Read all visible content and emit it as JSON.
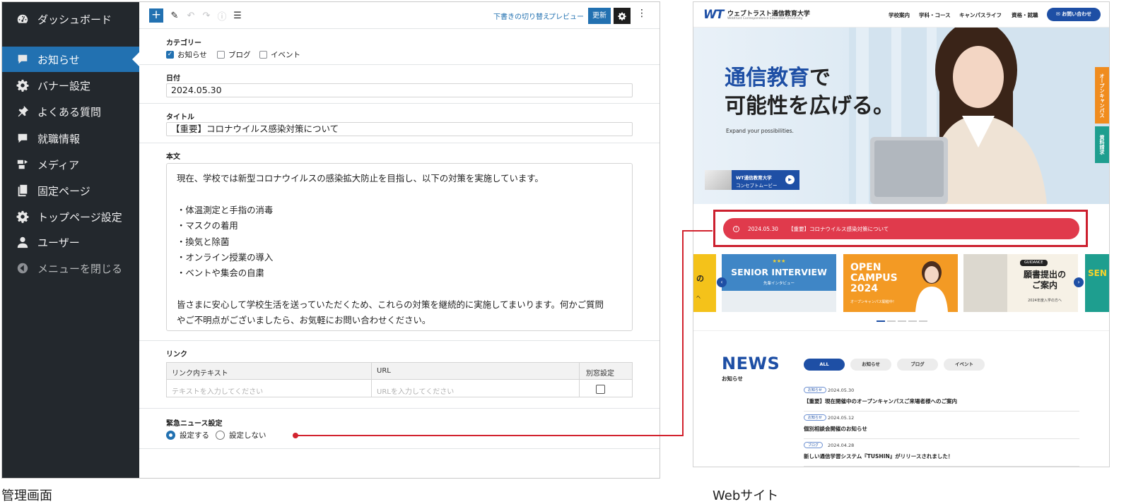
{
  "admin": {
    "sidebar": {
      "items": [
        {
          "label": "ダッシュボード",
          "icon": "dashboard-icon"
        },
        {
          "label": "お知らせ",
          "icon": "comment-icon",
          "active": true
        },
        {
          "label": "バナー設定",
          "icon": "gear-icon"
        },
        {
          "label": "よくある質問",
          "icon": "pin-icon"
        },
        {
          "label": "就職情報",
          "icon": "comment-icon"
        },
        {
          "label": "メディア",
          "icon": "media-icon"
        },
        {
          "label": "固定ページ",
          "icon": "pages-icon"
        },
        {
          "label": "トップページ設定",
          "icon": "gear-icon"
        },
        {
          "label": "ユーザー",
          "icon": "user-icon"
        },
        {
          "label": "メニューを閉じる",
          "icon": "collapse-icon"
        }
      ]
    },
    "toolbar": {
      "add": "+",
      "draft_switch": "下書きの切り替え",
      "preview": "プレビュー",
      "update": "更新"
    },
    "category": {
      "label": "カテゴリー",
      "options": [
        {
          "label": "お知らせ",
          "checked": true
        },
        {
          "label": "ブログ",
          "checked": false
        },
        {
          "label": "イベント",
          "checked": false
        }
      ]
    },
    "date": {
      "label": "日付",
      "value": "2024.05.30"
    },
    "title": {
      "label": "タイトル",
      "value": "【重要】コロナウイルス感染対策について"
    },
    "body": {
      "label": "本文",
      "lines": [
        "現在、学校では新型コロナウイルスの感染拡大防止を目指し、以下の対策を実施しています。",
        "・体温測定と手指の消毒",
        "・マスクの着用",
        "・換気と除菌",
        "・オンライン授業の導入",
        "・ベントや集会の自粛",
        "皆さまに安心して学校生活を送っていただくため、これらの対策を継続的に実施してまいります。何かご質問",
        "やご不明点がございましたら、お気軽にお問い合わせください。"
      ]
    },
    "link": {
      "label": "リンク",
      "columns": [
        "リンク内テキスト",
        "URL",
        "別窓設定"
      ],
      "placeholders": [
        "テキストを入力してください",
        "URLを入力してください"
      ]
    },
    "emergency": {
      "label": "緊急ニュース設定",
      "options": [
        {
          "label": "設定する",
          "selected": true
        },
        {
          "label": "設定しない",
          "selected": false
        }
      ]
    }
  },
  "site": {
    "logo": "WT",
    "name": "ウェブトラスト通信教育大学",
    "name_en": "Webtrust Correspondence Education University",
    "nav": [
      "学校案内",
      "学科・コース",
      "キャンパスライフ",
      "資格・就職"
    ],
    "contact": "✉ お問い合わせ",
    "hero": {
      "title_blue": "通信教育",
      "title_rest1": "で",
      "title_line2": "可能性を広げる。",
      "subtitle": "Expand your possibilities.",
      "movie_line1": "WT通信教育大学",
      "movie_line2": "コンセプトムービー"
    },
    "side_tabs": [
      "オープンキャンパス",
      "資料請求"
    ],
    "alert": {
      "date": "2024.05.30",
      "title": "【重要】コロナウイルス感染対策について"
    },
    "banners": {
      "senior": {
        "title": "SENIOR INTERVIEW",
        "sub": "先輩インタビュー"
      },
      "open": {
        "title1": "OPEN",
        "title2": "CAMPUS",
        "title3": "2024",
        "sub": "オープンキャンパス開催中！"
      },
      "guidance": {
        "tag": "GUIDANCE",
        "title1": "願書提出の",
        "title2": "ご案内",
        "sub": "2024年度入学の方へ"
      },
      "edge_left": "の",
      "edge_left2": "へ",
      "edge_right": "SEN"
    },
    "news": {
      "title": "NEWS",
      "subtitle": "お知らせ",
      "tabs": [
        "ALL",
        "お知らせ",
        "ブログ",
        "イベント"
      ],
      "items": [
        {
          "tag": "お知らせ",
          "date": "2024.05.30",
          "title": "【重要】現在開催中のオープンキャンパスご来場者様へのご案内"
        },
        {
          "tag": "お知らせ",
          "date": "2024.05.12",
          "title": "個別相談会開催のお知らせ"
        },
        {
          "tag": "ブログ",
          "date": "2024.04.28",
          "title": "新しい通信学習システム『TUSHIN』がリリースされました！"
        }
      ]
    }
  },
  "captions": {
    "admin": "管理画面",
    "site": "Webサイト"
  },
  "colors": {
    "wp_blue": "#2271b1",
    "sidebar": "#23282d",
    "site_blue": "#1e4fa5",
    "alert_red": "#e03a4c",
    "connector": "#d2232e"
  }
}
